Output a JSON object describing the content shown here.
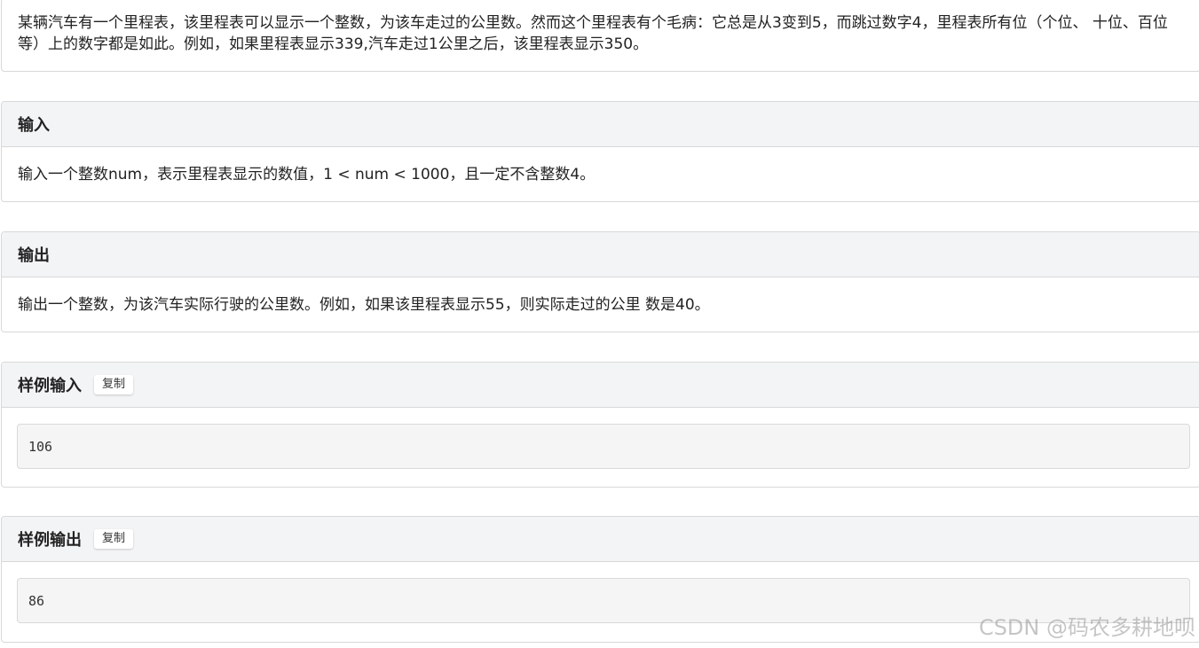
{
  "description": {
    "text": "某辆汽车有一个里程表，该里程表可以显示一个整数，为该车走过的公里数。然而这个里程表有个毛病：它总是从3变到5，而跳过数字4，里程表所有位（个位、 十位、百位等）上的数字都是如此。例如，如果里程表显示339,汽车走过1公里之后，该里程表显示350。"
  },
  "input_section": {
    "title": "输入",
    "text": "输入一个整数num，表示里程表显示的数值，1 < num < 1000，且一定不含整数4。"
  },
  "output_section": {
    "title": "输出",
    "text": "输出一个整数，为该汽车实际行驶的公里数。例如，如果该里程表显示55，则实际走过的公里 数是40。"
  },
  "sample_input": {
    "title": "样例输入",
    "copy_label": "复制",
    "value": "106"
  },
  "sample_output": {
    "title": "样例输出",
    "copy_label": "复制",
    "value": "86"
  },
  "watermark": "CSDN @码农多耕地呗"
}
